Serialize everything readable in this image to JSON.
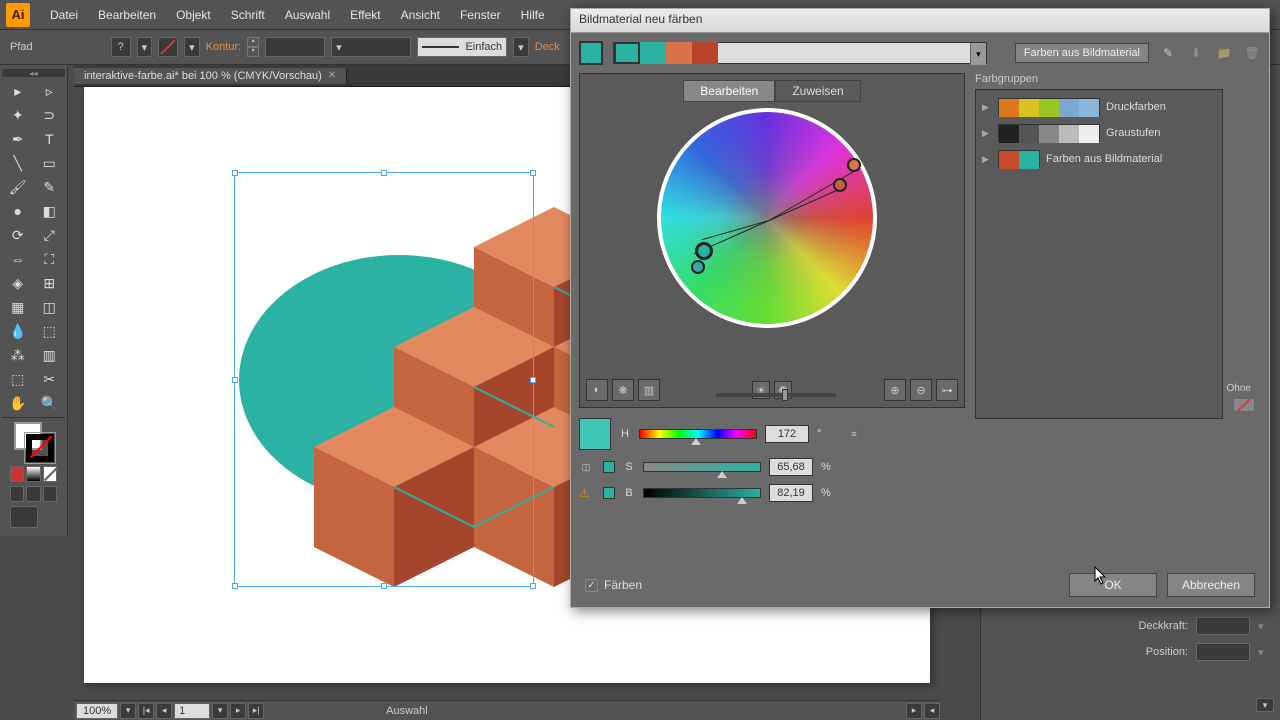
{
  "app": {
    "logo": "Ai"
  },
  "menu": [
    "Datei",
    "Bearbeiten",
    "Objekt",
    "Schrift",
    "Auswahl",
    "Effekt",
    "Ansicht",
    "Fenster",
    "Hilfe"
  ],
  "controlbar": {
    "object_label": "Pfad",
    "kontur_label": "Kontur:",
    "stroke_style": "Einfach",
    "deck_label": "Deck"
  },
  "doctab": {
    "title": "interaktive-farbe.ai* bei 100 % (CMYK/Vorschau)"
  },
  "statusbar": {
    "zoom": "100%",
    "page": "1",
    "selection": "Auswahl"
  },
  "right_panel": {
    "deckkraft": "Deckkraft:",
    "position": "Position:"
  },
  "dialog": {
    "title": "Bildmaterial neu färben",
    "from_artwork_btn": "Farben aus Bildmaterial",
    "tabs": {
      "edit": "Bearbeiten",
      "assign": "Zuweisen"
    },
    "hsb": {
      "h_label": "H",
      "h_val": "172",
      "h_unit": "°",
      "s_label": "S",
      "s_val": "65,68",
      "s_unit": "%",
      "b_label": "B",
      "b_val": "82,19",
      "b_unit": "%"
    },
    "ohne": "Ohne",
    "groups_label": "Farbgruppen",
    "groups": [
      {
        "label": "Druckfarben",
        "colors": [
          "#e07822",
          "#d9c322",
          "#9ac722",
          "#7aa8d0",
          "#8ab7d9"
        ]
      },
      {
        "label": "Graustufen",
        "colors": [
          "#222",
          "#555",
          "#888",
          "#bbb",
          "#eee"
        ]
      },
      {
        "label": "Farben aus Bildmaterial",
        "colors": [
          "#c94a2b",
          "#2cb2a3"
        ]
      }
    ],
    "tint_checkbox": "Färben",
    "ok": "OK",
    "cancel": "Abbrechen",
    "strip_colors": [
      "#2cb2a3",
      "#2cb2a3",
      "#d9734a",
      "#b8432a"
    ]
  },
  "artwork": {
    "teal": "#2cb2a3",
    "cube_light": "#e28960",
    "cube_mid": "#c5653f",
    "cube_dark": "#a5462c"
  }
}
